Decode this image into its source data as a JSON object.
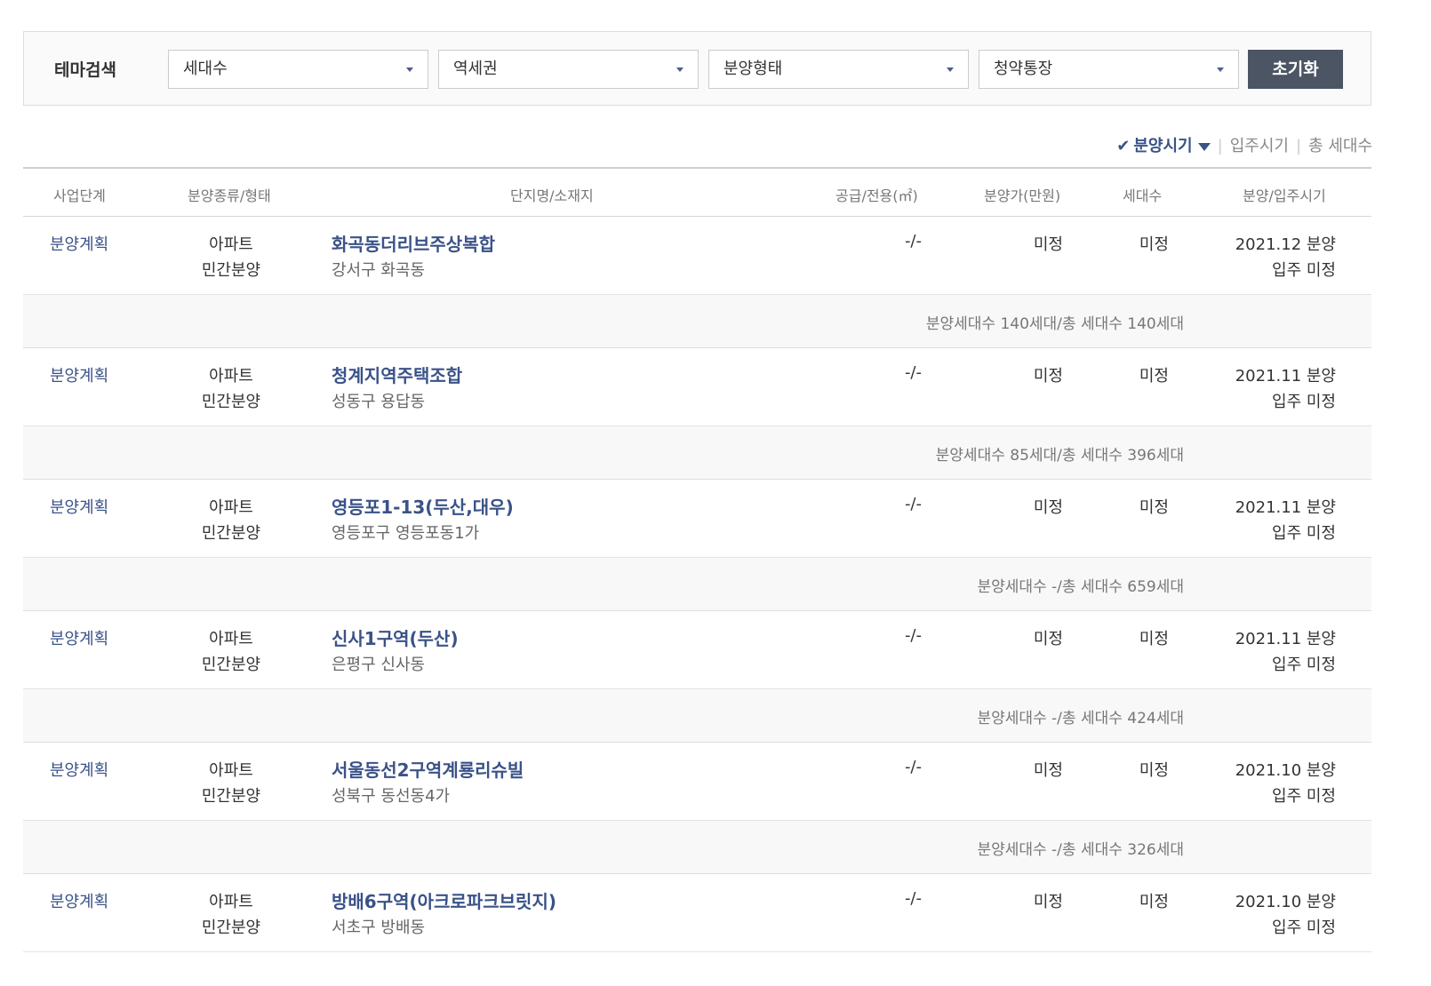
{
  "filters": {
    "label": "테마검색",
    "selects": [
      {
        "name": "households-select",
        "value": "세대수"
      },
      {
        "name": "station-area-select",
        "value": "역세권"
      },
      {
        "name": "sale-type-select",
        "value": "분양형태"
      },
      {
        "name": "subscription-account-select",
        "value": "청약통장"
      }
    ],
    "reset_label": "초기화"
  },
  "sort": {
    "active": "분양시기",
    "options": [
      "입주시기",
      "총 세대수"
    ]
  },
  "table": {
    "headers": {
      "stage": "사업단계",
      "type": "분양종류/형태",
      "name": "단지명/소재지",
      "supply": "공급/전용(㎡)",
      "price": "분양가(만원)",
      "units": "세대수",
      "date": "분양/입주시기"
    },
    "rows": [
      {
        "stage": "분양계획",
        "type1": "아파트",
        "type2": "민간분양",
        "name": "화곡동더리브주상복합",
        "location": "강서구 화곡동",
        "supply": "-/-",
        "price": "미정",
        "units": "미정",
        "sale_date": "2021.12 분양",
        "move_in": "입주 미정",
        "detail": "분양세대수 140세대/총 세대수 140세대"
      },
      {
        "stage": "분양계획",
        "type1": "아파트",
        "type2": "민간분양",
        "name": "청계지역주택조합",
        "location": "성동구 용답동",
        "supply": "-/-",
        "price": "미정",
        "units": "미정",
        "sale_date": "2021.11 분양",
        "move_in": "입주 미정",
        "detail": "분양세대수 85세대/총 세대수 396세대"
      },
      {
        "stage": "분양계획",
        "type1": "아파트",
        "type2": "민간분양",
        "name": "영등포1-13(두산,대우)",
        "location": "영등포구 영등포동1가",
        "supply": "-/-",
        "price": "미정",
        "units": "미정",
        "sale_date": "2021.11 분양",
        "move_in": "입주 미정",
        "detail": "분양세대수 -/총 세대수 659세대"
      },
      {
        "stage": "분양계획",
        "type1": "아파트",
        "type2": "민간분양",
        "name": "신사1구역(두산)",
        "location": "은평구 신사동",
        "supply": "-/-",
        "price": "미정",
        "units": "미정",
        "sale_date": "2021.11 분양",
        "move_in": "입주 미정",
        "detail": "분양세대수 -/총 세대수 424세대"
      },
      {
        "stage": "분양계획",
        "type1": "아파트",
        "type2": "민간분양",
        "name": "서울동선2구역계룡리슈빌",
        "location": "성북구 동선동4가",
        "supply": "-/-",
        "price": "미정",
        "units": "미정",
        "sale_date": "2021.10 분양",
        "move_in": "입주 미정",
        "detail": "분양세대수 -/총 세대수 326세대"
      },
      {
        "stage": "분양계획",
        "type1": "아파트",
        "type2": "민간분양",
        "name": "방배6구역(아크로파크브릿지)",
        "location": "서초구 방배동",
        "supply": "-/-",
        "price": "미정",
        "units": "미정",
        "sale_date": "2021.10 분양",
        "move_in": "입주 미정",
        "detail": ""
      }
    ]
  }
}
